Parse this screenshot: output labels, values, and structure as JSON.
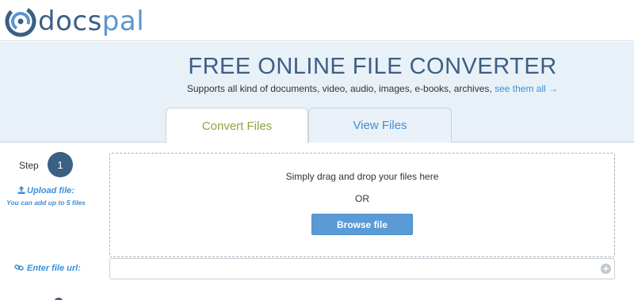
{
  "brand": {
    "name_part1": "docs",
    "name_part2": "pal",
    "logo_icon": "docspal-logo-icon",
    "primary_color": "#3c5f84",
    "accent_color": "#5a95cf"
  },
  "hero": {
    "title": "FREE ONLINE FILE CONVERTER",
    "subtitle": "Supports all kind of documents, video, audio, images, e-books, archives,",
    "see_all_link": "see them all →"
  },
  "tabs": [
    {
      "label": "Convert Files",
      "active": true,
      "color": "#8aa641"
    },
    {
      "label": "View Files",
      "active": false,
      "color": "#3d8ed6"
    }
  ],
  "step": {
    "label": "Step",
    "number": "1"
  },
  "upload": {
    "icon": "upload-icon",
    "label": "Upload file:",
    "hint": "You can add up to 5 files"
  },
  "dropzone": {
    "text": "Simply drag and drop your files here",
    "or": "OR",
    "browse_label": "Browse file",
    "button_color": "#5a9bd5"
  },
  "url": {
    "icon": "link-icon",
    "label": "Enter file url:",
    "value": "",
    "placeholder": "",
    "add_icon": "plus-circle-icon"
  }
}
